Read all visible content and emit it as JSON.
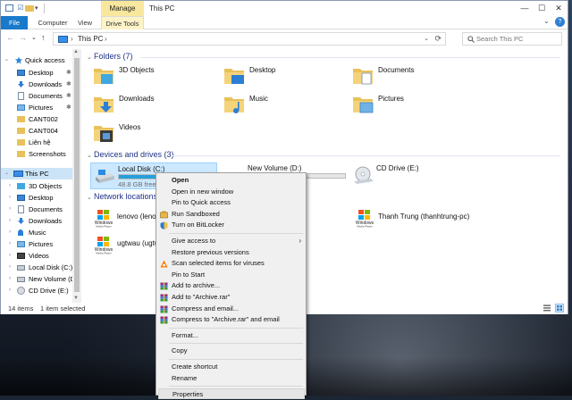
{
  "titlebar": {
    "manage_tab": "Manage",
    "title": "This PC",
    "minimize": "—",
    "maximize": "☐",
    "close": "✕"
  },
  "ribbon": {
    "tabs": [
      "File",
      "Computer",
      "View",
      "Drive Tools"
    ],
    "toggle": "⌄",
    "help": "?"
  },
  "nav": {
    "back": "←",
    "forward": "→",
    "recent": "⌄",
    "up": "↑",
    "address_chevron_1": "›",
    "address": "This PC",
    "address_chevron_2": "›",
    "address_dropdown": "⌄",
    "refresh": "⟳",
    "search_placeholder": "Search This PC"
  },
  "sidebar": {
    "quick_access": "Quick access",
    "quick_items": [
      {
        "label": "Desktop",
        "pin": "✱"
      },
      {
        "label": "Downloads",
        "pin": "✱"
      },
      {
        "label": "Documents",
        "pin": "✱"
      },
      {
        "label": "Pictures",
        "pin": "✱"
      },
      {
        "label": "CANT002",
        "pin": ""
      },
      {
        "label": "CANT004",
        "pin": ""
      },
      {
        "label": "Liên hệ",
        "pin": ""
      },
      {
        "label": "Screenshots",
        "pin": ""
      }
    ],
    "this_pc": "This PC",
    "pc_items": [
      "3D Objects",
      "Desktop",
      "Documents",
      "Downloads",
      "Music",
      "Pictures",
      "Videos",
      "Local Disk (C:)",
      "New Volume (D:",
      "CD Drive (E:)"
    ],
    "chev_expanded": "⌄",
    "chev_collapsed": "›"
  },
  "content": {
    "folders_header": "Folders (7)",
    "folders": [
      {
        "label": "3D Objects",
        "badge": "#3ea8e0"
      },
      {
        "label": "Desktop",
        "badge": "#2d7fd4"
      },
      {
        "label": "Documents",
        "badge": "#ffffff"
      },
      {
        "label": "Downloads",
        "badge": "#2b7fd6"
      },
      {
        "label": "Music",
        "badge": "#2b7fd6"
      },
      {
        "label": "Pictures",
        "badge": "#6fb2e8"
      },
      {
        "label": "Videos",
        "badge": "#3b3b3b"
      }
    ],
    "devices_header": "Devices and drives (3)",
    "drives": [
      {
        "label": "Local Disk (C:)",
        "free": "48.8 GB free of",
        "used": 0.55
      },
      {
        "label": "New Volume (D:)",
        "free": "",
        "used": 0.6
      },
      {
        "label": "CD Drive (E:)",
        "free": "",
        "used": 0
      }
    ],
    "network_header": "Network locations",
    "network": [
      {
        "label": "lenovo (lenov",
        "logo": "Windows Media Player"
      },
      {
        "label": "Thanh Trung (thanhtrung-pc)",
        "logo": "Windows Media Player"
      },
      {
        "label": "ugtwau (ugtw",
        "logo": "Windows Media Player"
      }
    ]
  },
  "status": {
    "items": "14 items",
    "selected": "1 item selected"
  },
  "context_menu": [
    {
      "label": "Open",
      "bold": true,
      "icon": ""
    },
    {
      "label": "Open in new window",
      "icon": ""
    },
    {
      "label": "Pin to Quick access",
      "icon": ""
    },
    {
      "label": "Run Sandboxed",
      "icon": "sandboxie-icon"
    },
    {
      "label": "Turn on BitLocker",
      "icon": "shield-icon"
    },
    {
      "sep": true
    },
    {
      "label": "Give access to",
      "icon": "",
      "arrow": "›"
    },
    {
      "label": "Restore previous versions",
      "icon": ""
    },
    {
      "label": "Scan selected items for viruses",
      "icon": "antivirus-icon"
    },
    {
      "label": "Pin to Start",
      "icon": ""
    },
    {
      "label": "Add to archive...",
      "icon": "winrar-icon"
    },
    {
      "label": "Add to \"Archive.rar\"",
      "icon": "winrar-icon"
    },
    {
      "label": "Compress and email...",
      "icon": "winrar-icon"
    },
    {
      "label": "Compress to \"Archive.rar\" and email",
      "icon": "winrar-icon"
    },
    {
      "sep": true
    },
    {
      "label": "Format...",
      "icon": ""
    },
    {
      "sep": true
    },
    {
      "label": "Copy",
      "icon": ""
    },
    {
      "sep": true
    },
    {
      "label": "Create shortcut",
      "icon": ""
    },
    {
      "label": "Rename",
      "icon": ""
    },
    {
      "sep": true
    },
    {
      "label": "Properties",
      "icon": "",
      "hover": true
    }
  ],
  "colors": {
    "accent": "#1979ca",
    "selection": "#cce8ff",
    "drive_fill": "#26a0da",
    "header_blue": "#1e3287",
    "manage_tab": "#f8e79d"
  }
}
